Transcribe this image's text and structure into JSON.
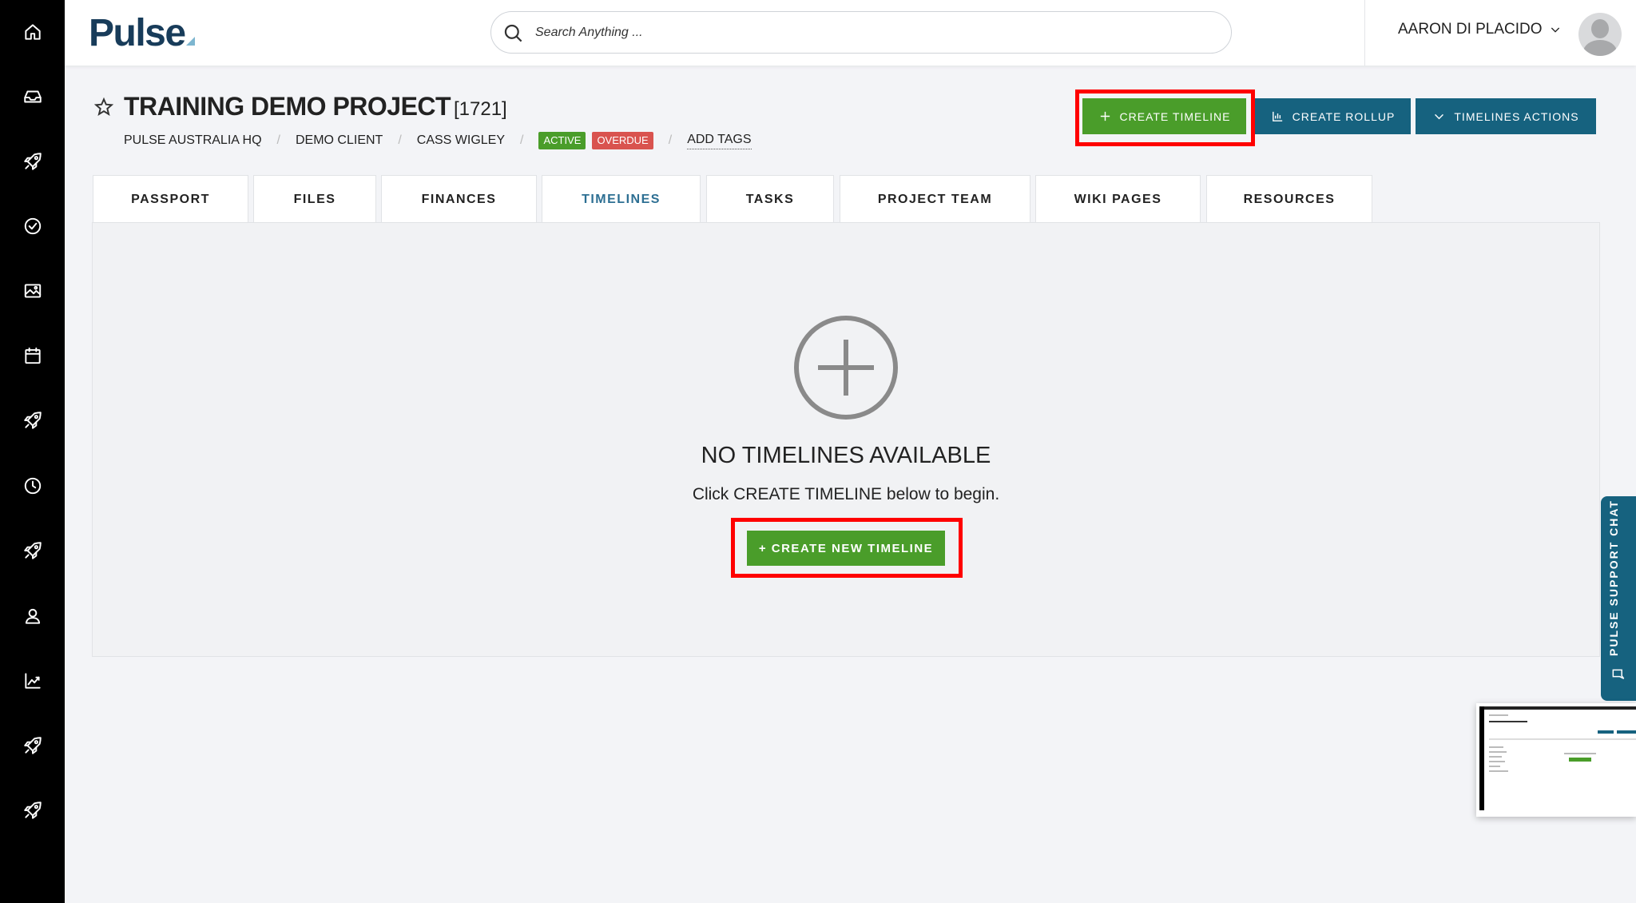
{
  "app": {
    "logo_text": "Pulse",
    "search_placeholder": "Search Anything ...",
    "user_name": "AARON DI PLACIDO"
  },
  "sidebar": {
    "items": [
      {
        "icon": "home-icon"
      },
      {
        "icon": "inbox-icon"
      },
      {
        "icon": "rocket-icon"
      },
      {
        "icon": "check-circle-icon"
      },
      {
        "icon": "image-icon"
      },
      {
        "icon": "calendar-icon"
      },
      {
        "icon": "rocket-icon"
      },
      {
        "icon": "clock-icon"
      },
      {
        "icon": "rocket-icon"
      },
      {
        "icon": "user-icon"
      },
      {
        "icon": "chart-icon"
      },
      {
        "icon": "rocket-icon"
      },
      {
        "icon": "rocket-icon"
      }
    ]
  },
  "project": {
    "title": "TRAINING DEMO PROJECT",
    "id": "[1721]",
    "breadcrumb": [
      "PULSE AUSTRALIA HQ",
      "DEMO CLIENT",
      "CASS WIGLEY"
    ],
    "separator": "/",
    "status_active": "ACTIVE",
    "status_overdue": "OVERDUE",
    "add_tags": "ADD TAGS"
  },
  "actions": {
    "create_timeline": "CREATE TIMELINE",
    "create_rollup": "CREATE ROLLUP",
    "timelines_actions": "TIMELINES ACTIONS"
  },
  "tabs": [
    {
      "label": "PASSPORT"
    },
    {
      "label": "FILES"
    },
    {
      "label": "FINANCES"
    },
    {
      "label": "TIMELINES",
      "selected": true
    },
    {
      "label": "TASKS"
    },
    {
      "label": "PROJECT TEAM"
    },
    {
      "label": "WIKI PAGES"
    },
    {
      "label": "RESOURCES"
    }
  ],
  "empty_state": {
    "title": "NO TIMELINES AVAILABLE",
    "subtitle": "Click CREATE TIMELINE below to begin.",
    "button": "+ CREATE NEW TIMELINE"
  },
  "support_chat": {
    "label": "PULSE SUPPORT CHAT"
  },
  "colors": {
    "green": "#4a9d2a",
    "teal": "#16627f",
    "highlight": "#ff0000",
    "overdue": "#d9534f",
    "selected_tab": "#2d6f93"
  }
}
